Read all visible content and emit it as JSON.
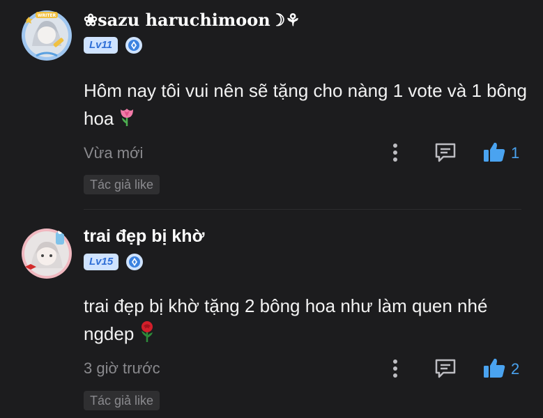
{
  "comments": [
    {
      "username": "❀sazu haruchimoon☽⚘",
      "level": "Lv11",
      "text": "Hôm nay tôi vui nên sẽ tặng cho nàng 1 vote và 1 bông hoa",
      "emoji_icon": "tulip-icon",
      "time": "Vừa mới",
      "like_count": "1",
      "author_like_label": "Tác giả like",
      "avatar_badge_text": "WRITER"
    },
    {
      "username": "trai đẹp bị khờ",
      "level": "Lv15",
      "text": "trai đẹp bị khờ tặng 2 bông hoa như làm quen nhé ngdep",
      "emoji_icon": "rose-icon",
      "time": "3 giờ trước",
      "like_count": "2",
      "author_like_label": "Tác giả like"
    }
  ],
  "colors": {
    "background": "#1c1c1e",
    "like_blue": "#4aa3f0",
    "level_badge_bg": "#cfe3ff",
    "level_badge_text": "#2f6fd6",
    "muted_text": "#8a8a8e"
  }
}
